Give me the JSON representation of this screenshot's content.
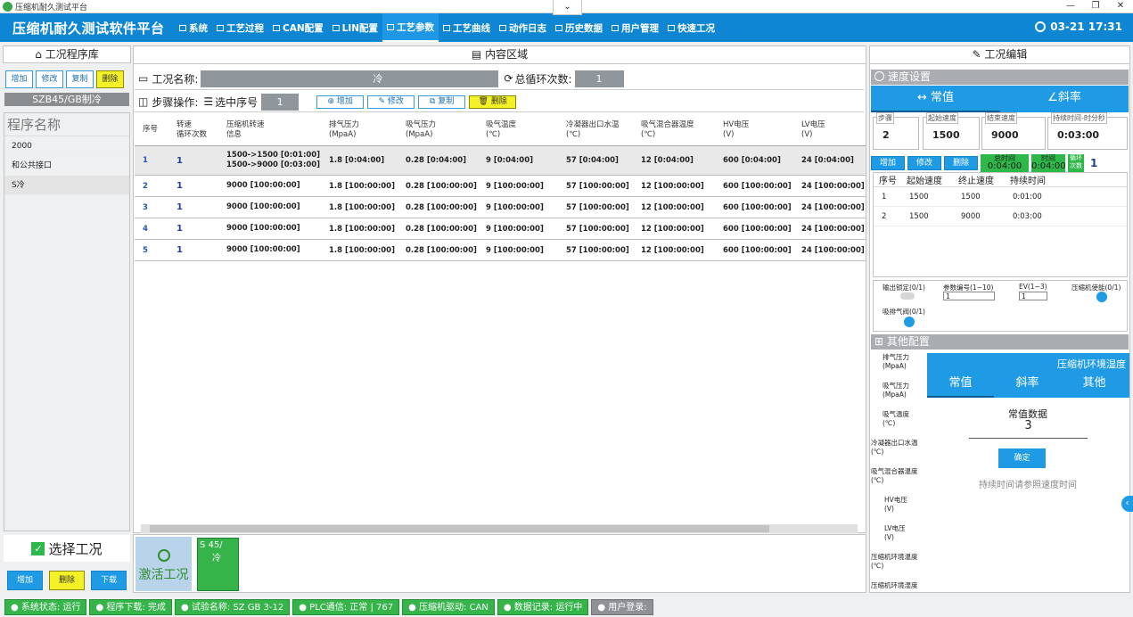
{
  "window": {
    "title": "压缩机耐久测试平台",
    "collapse_icon": "chevron-down-icon"
  },
  "menubar": {
    "brand": "压缩机耐久测试软件平台",
    "items": [
      {
        "label": "系统"
      },
      {
        "label": "工艺过程"
      },
      {
        "label": "CAN配置"
      },
      {
        "label": "LIN配置"
      },
      {
        "label": "工艺参数"
      },
      {
        "label": "工艺曲线"
      },
      {
        "label": "动作日志"
      },
      {
        "label": "历史数据"
      },
      {
        "label": "用户管理"
      },
      {
        "label": "快速工况"
      }
    ],
    "active_index": 4,
    "clock": "03-21 17:31"
  },
  "left": {
    "title": "工况程序库",
    "btns": {
      "add": "增加",
      "edit": "修改",
      "copy": "复制",
      "del": "删除"
    },
    "program": "SZB45/GB制冷",
    "list_header": "程序名称",
    "items": [
      "2000",
      "和公共接口",
      "S冷"
    ],
    "selected_index": 2,
    "select_label": "选择工况",
    "bottom": {
      "add": "增加",
      "del": "删除",
      "download": "下载"
    }
  },
  "mid": {
    "title": "内容区域",
    "cond_name_label": "工况名称:",
    "cond_name_value": "冷",
    "loop_label": "总循环次数:",
    "loop_value": "1",
    "step_label": "步骤操作:",
    "sel_label": "选中序号",
    "sel_value": "1",
    "step_btns": {
      "add": "增加",
      "edit": "修改",
      "copy": "复制",
      "del": "删除"
    },
    "table": {
      "headers": [
        [
          "序号",
          ""
        ],
        [
          "转速",
          "循环次数"
        ],
        [
          "压缩机转速",
          "信息"
        ],
        [
          "排气压力",
          "(MpaA)"
        ],
        [
          "吸气压力",
          "(MpaA)"
        ],
        [
          "吸气温度",
          "(℃)"
        ],
        [
          "冷凝器出口水温",
          "(℃)"
        ],
        [
          "吸气混合器温度",
          "(℃)"
        ],
        [
          "HV电压",
          "(V)"
        ],
        [
          "LV电压",
          "(V)"
        ]
      ],
      "rows": [
        {
          "idx": "1",
          "loop": "1",
          "speed": [
            "1500->1500 [0:01:00]",
            "1500->9000 [0:03:00]"
          ],
          "pd": "1.8 [0:04:00]",
          "ps": "0.28 [0:04:00]",
          "ts": "9 [0:04:00]",
          "tw": "57 [0:04:00]",
          "tm": "12 [0:04:00]",
          "hv": "600 [0:04:00]",
          "lv": "24 [0:04:00]"
        },
        {
          "idx": "2",
          "loop": "1",
          "speed": [
            "9000 [100:00:00]"
          ],
          "pd": "1.8 [100:00:00]",
          "ps": "0.28 [100:00:00]",
          "ts": "9 [100:00:00]",
          "tw": "57 [100:00:00]",
          "tm": "12 [100:00:00]",
          "hv": "600 [100:00:00]",
          "lv": "24 [100:00:00]"
        },
        {
          "idx": "3",
          "loop": "1",
          "speed": [
            "9000 [100:00:00]"
          ],
          "pd": "1.8 [100:00:00]",
          "ps": "0.28 [100:00:00]",
          "ts": "9 [100:00:00]",
          "tw": "57 [100:00:00]",
          "tm": "12 [100:00:00]",
          "hv": "600 [100:00:00]",
          "lv": "24 [100:00:00]"
        },
        {
          "idx": "4",
          "loop": "1",
          "speed": [
            "9000 [100:00:00]"
          ],
          "pd": "1.8 [100:00:00]",
          "ps": "0.28 [100:00:00]",
          "ts": "9 [100:00:00]",
          "tw": "57 [100:00:00]",
          "tm": "12 [100:00:00]",
          "hv": "600 [100:00:00]",
          "lv": "24 [100:00:00]"
        },
        {
          "idx": "5",
          "loop": "1",
          "speed": [
            "9000 [100:00:00]"
          ],
          "pd": "1.8 [100:00:00]",
          "ps": "0.28 [100:00:00]",
          "ts": "9 [100:00:00]",
          "tw": "57 [100:00:00]",
          "tm": "12 [100:00:00]",
          "hv": "600 [100:00:00]",
          "lv": "24 [100:00:00]"
        }
      ]
    },
    "activate_label": "激活工况",
    "mini_card": {
      "line1": "S 45/",
      "line2": "冷"
    }
  },
  "right": {
    "title": "工况编辑",
    "speed_section": "速度设置",
    "speed_tabs": [
      "常值",
      "斜率"
    ],
    "fields": [
      {
        "label": "步骤",
        "value": "2"
      },
      {
        "label": "起始速度",
        "value": "1500"
      },
      {
        "label": "结束速度",
        "value": "9000"
      },
      {
        "label": "持续时间-时分秒",
        "value": "0:03:00"
      }
    ],
    "seg_btns": {
      "add": "增加",
      "edit": "修改",
      "del": "删除"
    },
    "total_time_label": "总时间",
    "total_time": "0:04:00",
    "time_label": "时间",
    "time": "0:04:00",
    "loop_label": "循环次数",
    "loop_value": "1",
    "seg_headers": [
      "序号",
      "起始速度",
      "终止速度",
      "持续时间"
    ],
    "seg_rows": [
      [
        "1",
        "1500",
        "1500",
        "0:01:00"
      ],
      [
        "2",
        "1500",
        "9000",
        "0:03:00"
      ]
    ],
    "opts": {
      "out_lock": "输出锁定(0/1)",
      "param_no": "参数编号(1~10)",
      "param_val": "1",
      "ev": "EV(1~3)",
      "ev_val": "1",
      "enable": "压缩机使能(0/1)",
      "valve": "吸排气阀(0/1)"
    },
    "other_section": "其他配置",
    "cfg_labels": [
      "排气压力",
      "(MpaA)",
      "吸气压力",
      "(MpaA)",
      "吸气温度",
      "(℃)",
      "冷凝器出口水温",
      "(℃)",
      "吸气混合器温度",
      "(℃)",
      "HV电压",
      "(V)",
      "LV电压",
      "(V)",
      "压缩机环境温度",
      "(℃)",
      "压缩机环境湿度"
    ],
    "cfg_title": "压缩机环境湿度",
    "cfg_tabs": [
      "常值",
      "斜率",
      "其他"
    ],
    "const_label": "常值数据",
    "const_value": "3",
    "ok": "确定",
    "hint": "持续时间请参照速度时间"
  },
  "status": [
    "系统状态: 运行",
    "程序下载: 完成",
    "试验名称: SZ GB 3-12",
    "PLC通信: 正常 | 767",
    "压缩机驱动: CAN",
    "数据记录: 运行中",
    "用户登录:"
  ],
  "colors": {
    "primary": "#0f86d4",
    "accent": "#1f9be6",
    "ok": "#35b44a",
    "warn": "#f4f126"
  }
}
